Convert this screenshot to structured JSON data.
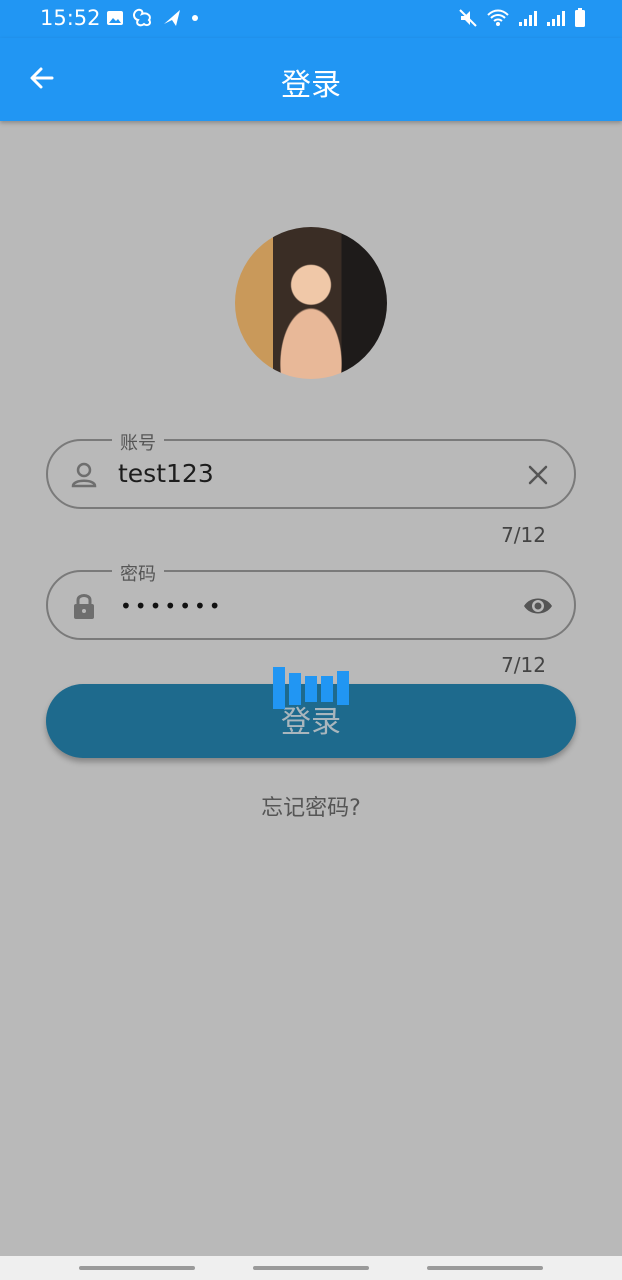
{
  "status_bar": {
    "time": "15:52",
    "left_icons": [
      "image-icon",
      "app-icon",
      "flight-icon",
      "dot-icon"
    ],
    "right_icons": [
      "mute-icon",
      "wifi-icon",
      "signal-icon",
      "signal-icon",
      "battery-icon"
    ]
  },
  "app_bar": {
    "title": "登录",
    "back_icon": "back-arrow-icon",
    "background": "#2196f3"
  },
  "form": {
    "account": {
      "label": "账号",
      "value": "test123",
      "counter": "7/12",
      "left_icon": "person-icon",
      "right_icon": "clear-icon"
    },
    "password": {
      "label": "密码",
      "value": "•••••••",
      "counter": "7/12",
      "left_icon": "lock-icon",
      "right_icon": "eye-icon"
    },
    "login_button": {
      "label": "登录",
      "background": "#1e6a8d"
    },
    "forgot_password": "忘记密码?"
  },
  "loading_indicator": {
    "icon": "loading-bars-icon",
    "color": "#2196f3"
  }
}
